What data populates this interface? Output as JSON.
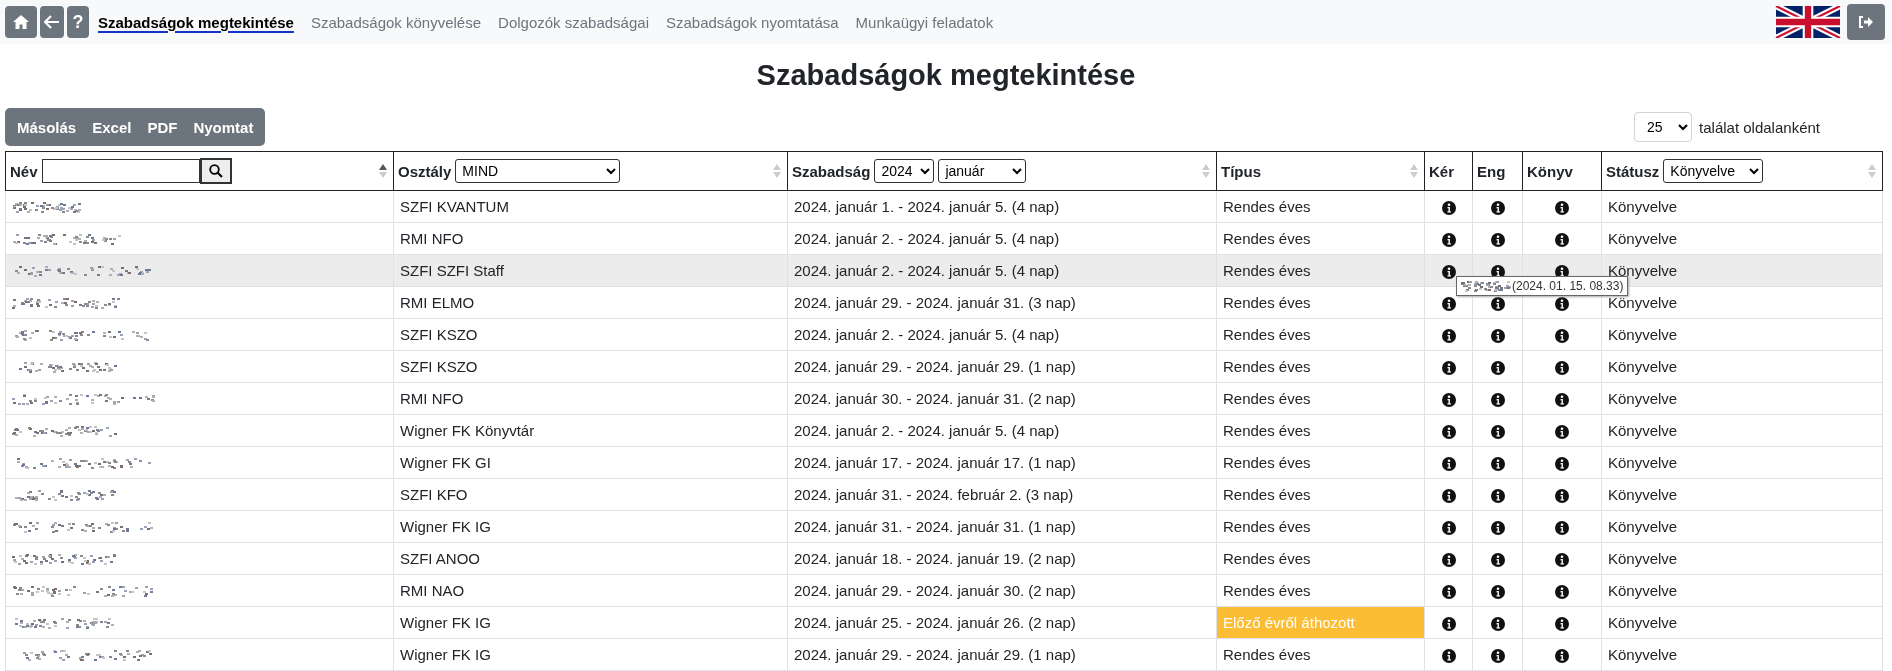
{
  "nav": {
    "buttons": [
      {
        "kind": "home"
      },
      {
        "kind": "back"
      },
      {
        "kind": "help",
        "label": "?"
      }
    ],
    "links": [
      {
        "label": "Szabadságok megtekintése",
        "selected": true
      },
      {
        "label": "Szabadságok könyvelése",
        "selected": false
      },
      {
        "label": "Dolgozók szabadságai",
        "selected": false
      },
      {
        "label": "Szabadságok nyomtatása",
        "selected": false
      },
      {
        "label": "Munkaügyi feladatok",
        "selected": false
      }
    ]
  },
  "title": "Szabadságok megtekintése",
  "export_buttons": [
    "Másolás",
    "Excel",
    "PDF",
    "Nyomtat"
  ],
  "page_size": {
    "value": "25",
    "label": "találat oldalanként"
  },
  "table": {
    "columns": [
      {
        "label": "Név",
        "filter": {
          "kind": "search"
        },
        "sorted_ascending": true
      },
      {
        "label": "Osztály",
        "filter": {
          "kind": "select",
          "values": [
            "MIND"
          ]
        },
        "sorted_ascending": false
      },
      {
        "label": "Szabadság",
        "filter": {
          "kind": "select",
          "values": [
            "2024",
            "január"
          ]
        },
        "sorted_ascending": false
      },
      {
        "label": "Típus",
        "sorted_ascending": false
      },
      {
        "label": "Kér"
      },
      {
        "label": "Eng"
      },
      {
        "label": "Könyv"
      },
      {
        "label": "Státusz",
        "filter": {
          "kind": "select",
          "values": [
            "Könyvelve"
          ]
        },
        "sorted_ascending": false
      }
    ],
    "rows": [
      {
        "department": "SZFI KVANTUM",
        "period": "2024. január 1. - 2024. január 5. (4 nap)",
        "type": "Rendes éves",
        "type_highlighted": false,
        "status": "Könyvelve",
        "hovered": false
      },
      {
        "department": "RMI NFO",
        "period": "2024. január 2. - 2024. január 5. (4 nap)",
        "type": "Rendes éves",
        "type_highlighted": false,
        "status": "Könyvelve",
        "hovered": false
      },
      {
        "department": "SZFI SZFI Staff",
        "period": "2024. január 2. - 2024. január 5. (4 nap)",
        "type": "Rendes éves",
        "type_highlighted": false,
        "status": "Könyvelve",
        "hovered": true,
        "tooltip": "(2024. 01. 15. 08.33)"
      },
      {
        "department": "RMI ELMO",
        "period": "2024. január 29. - 2024. január 31. (3 nap)",
        "type": "Rendes éves",
        "type_highlighted": false,
        "status": "Könyvelve",
        "hovered": false
      },
      {
        "department": "SZFI KSZO",
        "period": "2024. január 2. - 2024. január 5. (4 nap)",
        "type": "Rendes éves",
        "type_highlighted": false,
        "status": "Könyvelve",
        "hovered": false
      },
      {
        "department": "SZFI KSZO",
        "period": "2024. január 29. - 2024. január 29. (1 nap)",
        "type": "Rendes éves",
        "type_highlighted": false,
        "status": "Könyvelve",
        "hovered": false
      },
      {
        "department": "RMI NFO",
        "period": "2024. január 30. - 2024. január 31. (2 nap)",
        "type": "Rendes éves",
        "type_highlighted": false,
        "status": "Könyvelve",
        "hovered": false
      },
      {
        "department": "Wigner FK Könyvtár",
        "period": "2024. január 2. - 2024. január 5. (4 nap)",
        "type": "Rendes éves",
        "type_highlighted": false,
        "status": "Könyvelve",
        "hovered": false
      },
      {
        "department": "Wigner FK GI",
        "period": "2024. január 17. - 2024. január 17. (1 nap)",
        "type": "Rendes éves",
        "type_highlighted": false,
        "status": "Könyvelve",
        "hovered": false
      },
      {
        "department": "SZFI KFO",
        "period": "2024. január 31. - 2024. február 2. (3 nap)",
        "type": "Rendes éves",
        "type_highlighted": false,
        "status": "Könyvelve",
        "hovered": false
      },
      {
        "department": "Wigner FK IG",
        "period": "2024. január 31. - 2024. január 31. (1 nap)",
        "type": "Rendes éves",
        "type_highlighted": false,
        "status": "Könyvelve",
        "hovered": false
      },
      {
        "department": "SZFI ANOO",
        "period": "2024. január 18. - 2024. január 19. (2 nap)",
        "type": "Rendes éves",
        "type_highlighted": false,
        "status": "Könyvelve",
        "hovered": false
      },
      {
        "department": "RMI NAO",
        "period": "2024. január 29. - 2024. január 30. (2 nap)",
        "type": "Rendes éves",
        "type_highlighted": false,
        "status": "Könyvelve",
        "hovered": false
      },
      {
        "department": "Wigner FK IG",
        "period": "2024. január 25. - 2024. január 26. (2 nap)",
        "type": "Előző évről áthozott",
        "type_highlighted": true,
        "status": "Könyvelve",
        "hovered": false
      },
      {
        "department": "Wigner FK IG",
        "period": "2024. január 29. - 2024. január 29. (1 nap)",
        "type": "Rendes éves",
        "type_highlighted": false,
        "status": "Könyvelve",
        "hovered": false
      }
    ]
  }
}
